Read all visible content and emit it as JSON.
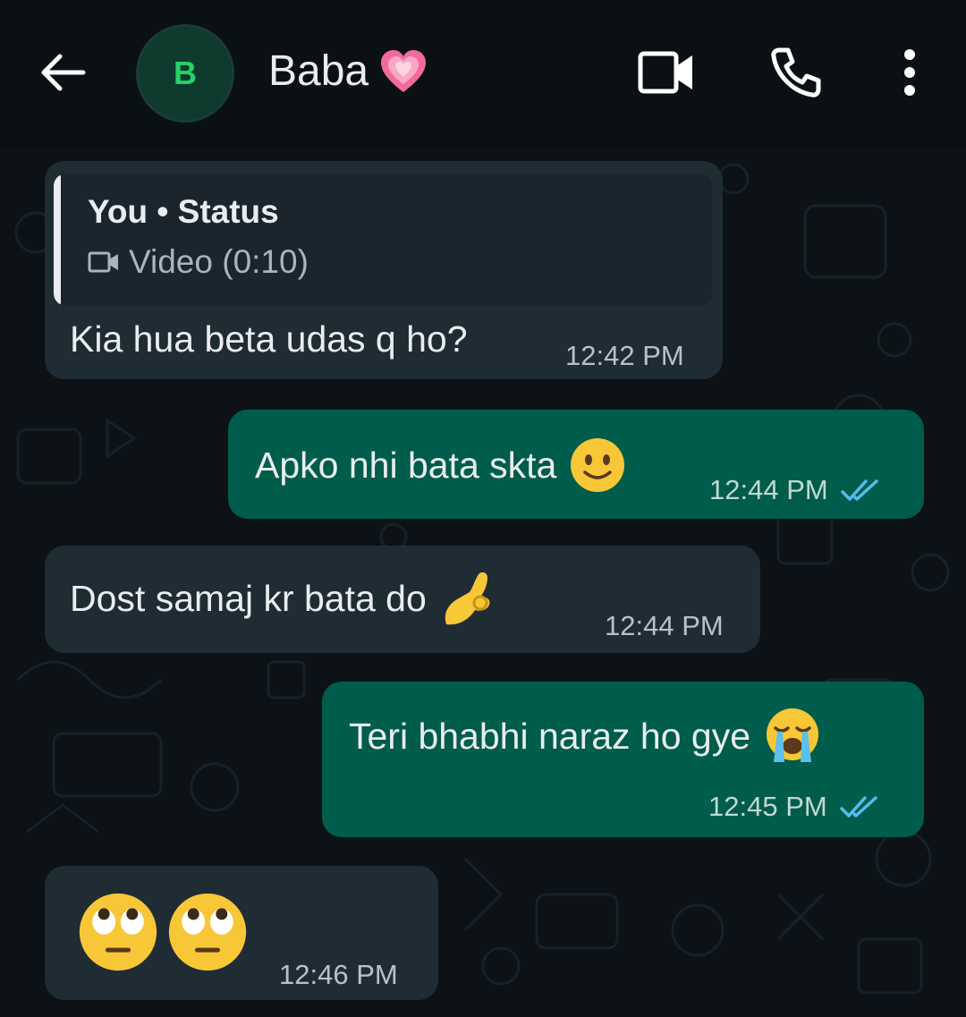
{
  "header": {
    "back_label": "back",
    "avatar_letter": "B",
    "contact_name": "Baba",
    "contact_emoji": "growing-heart",
    "icons": [
      "arrow-left-icon",
      "video-call-icon",
      "voice-call-icon",
      "more-vert-icon"
    ]
  },
  "messages": [
    {
      "direction": "incoming",
      "quote": {
        "title": "You • Status",
        "subtitle": "Video (0:10)",
        "icon": "video-icon"
      },
      "text": "Kia hua beta udas q ho?",
      "time": "12:42 PM"
    },
    {
      "direction": "outgoing",
      "text": "Apko nhi bata skta",
      "emoji": "slightly-smiling-face",
      "time": "12:44 PM",
      "status": "read"
    },
    {
      "direction": "incoming",
      "text": "Dost samaj kr bata do",
      "emoji": "pinched-fingers-ok",
      "time": "12:44 PM"
    },
    {
      "direction": "outgoing",
      "text": "Teri bhabhi naraz ho gye",
      "emoji": "loudly-crying-face",
      "time": "12:45 PM",
      "status": "read"
    },
    {
      "direction": "incoming",
      "text": "",
      "emoji": "face-with-rolling-eyes x2",
      "time": "12:46 PM"
    }
  ],
  "colors": {
    "background": "#0c1216",
    "incoming_bubble": "#1f2c34",
    "outgoing_bubble": "#005c4b",
    "read_ticks": "#53bdeb",
    "avatar_letter": "#25d366"
  }
}
